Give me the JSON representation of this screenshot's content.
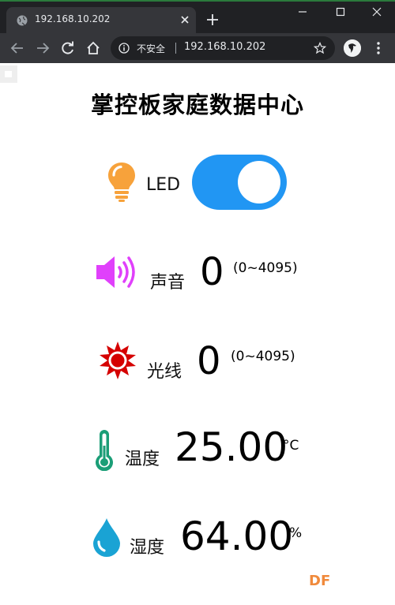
{
  "browser": {
    "tab_title": "192.168.10.202",
    "security_label": "不安全",
    "url": "192.168.10.202"
  },
  "page": {
    "title": "掌控板家庭数据中心",
    "led": {
      "label": "LED",
      "on": true
    },
    "sound": {
      "label": "声音",
      "value": "0",
      "range": "(0~4095)"
    },
    "light": {
      "label": "光线",
      "value": "0",
      "range": "(0~4095)"
    },
    "temperature": {
      "label": "温度",
      "value": "25.00",
      "unit": "°C"
    },
    "humidity": {
      "label": "湿度",
      "value": "64.00",
      "unit": "%"
    }
  },
  "watermark": "DF",
  "colors": {
    "switch_on": "#2196f3",
    "bulb": "#f7a23b",
    "speaker": "#e040fb",
    "sun": "#d50000",
    "thermometer": "#1b9e77",
    "drop": "#1aa3d4"
  },
  "icons": [
    "lightbulb-icon",
    "speaker-icon",
    "sun-icon",
    "thermometer-icon",
    "water-drop-icon"
  ]
}
